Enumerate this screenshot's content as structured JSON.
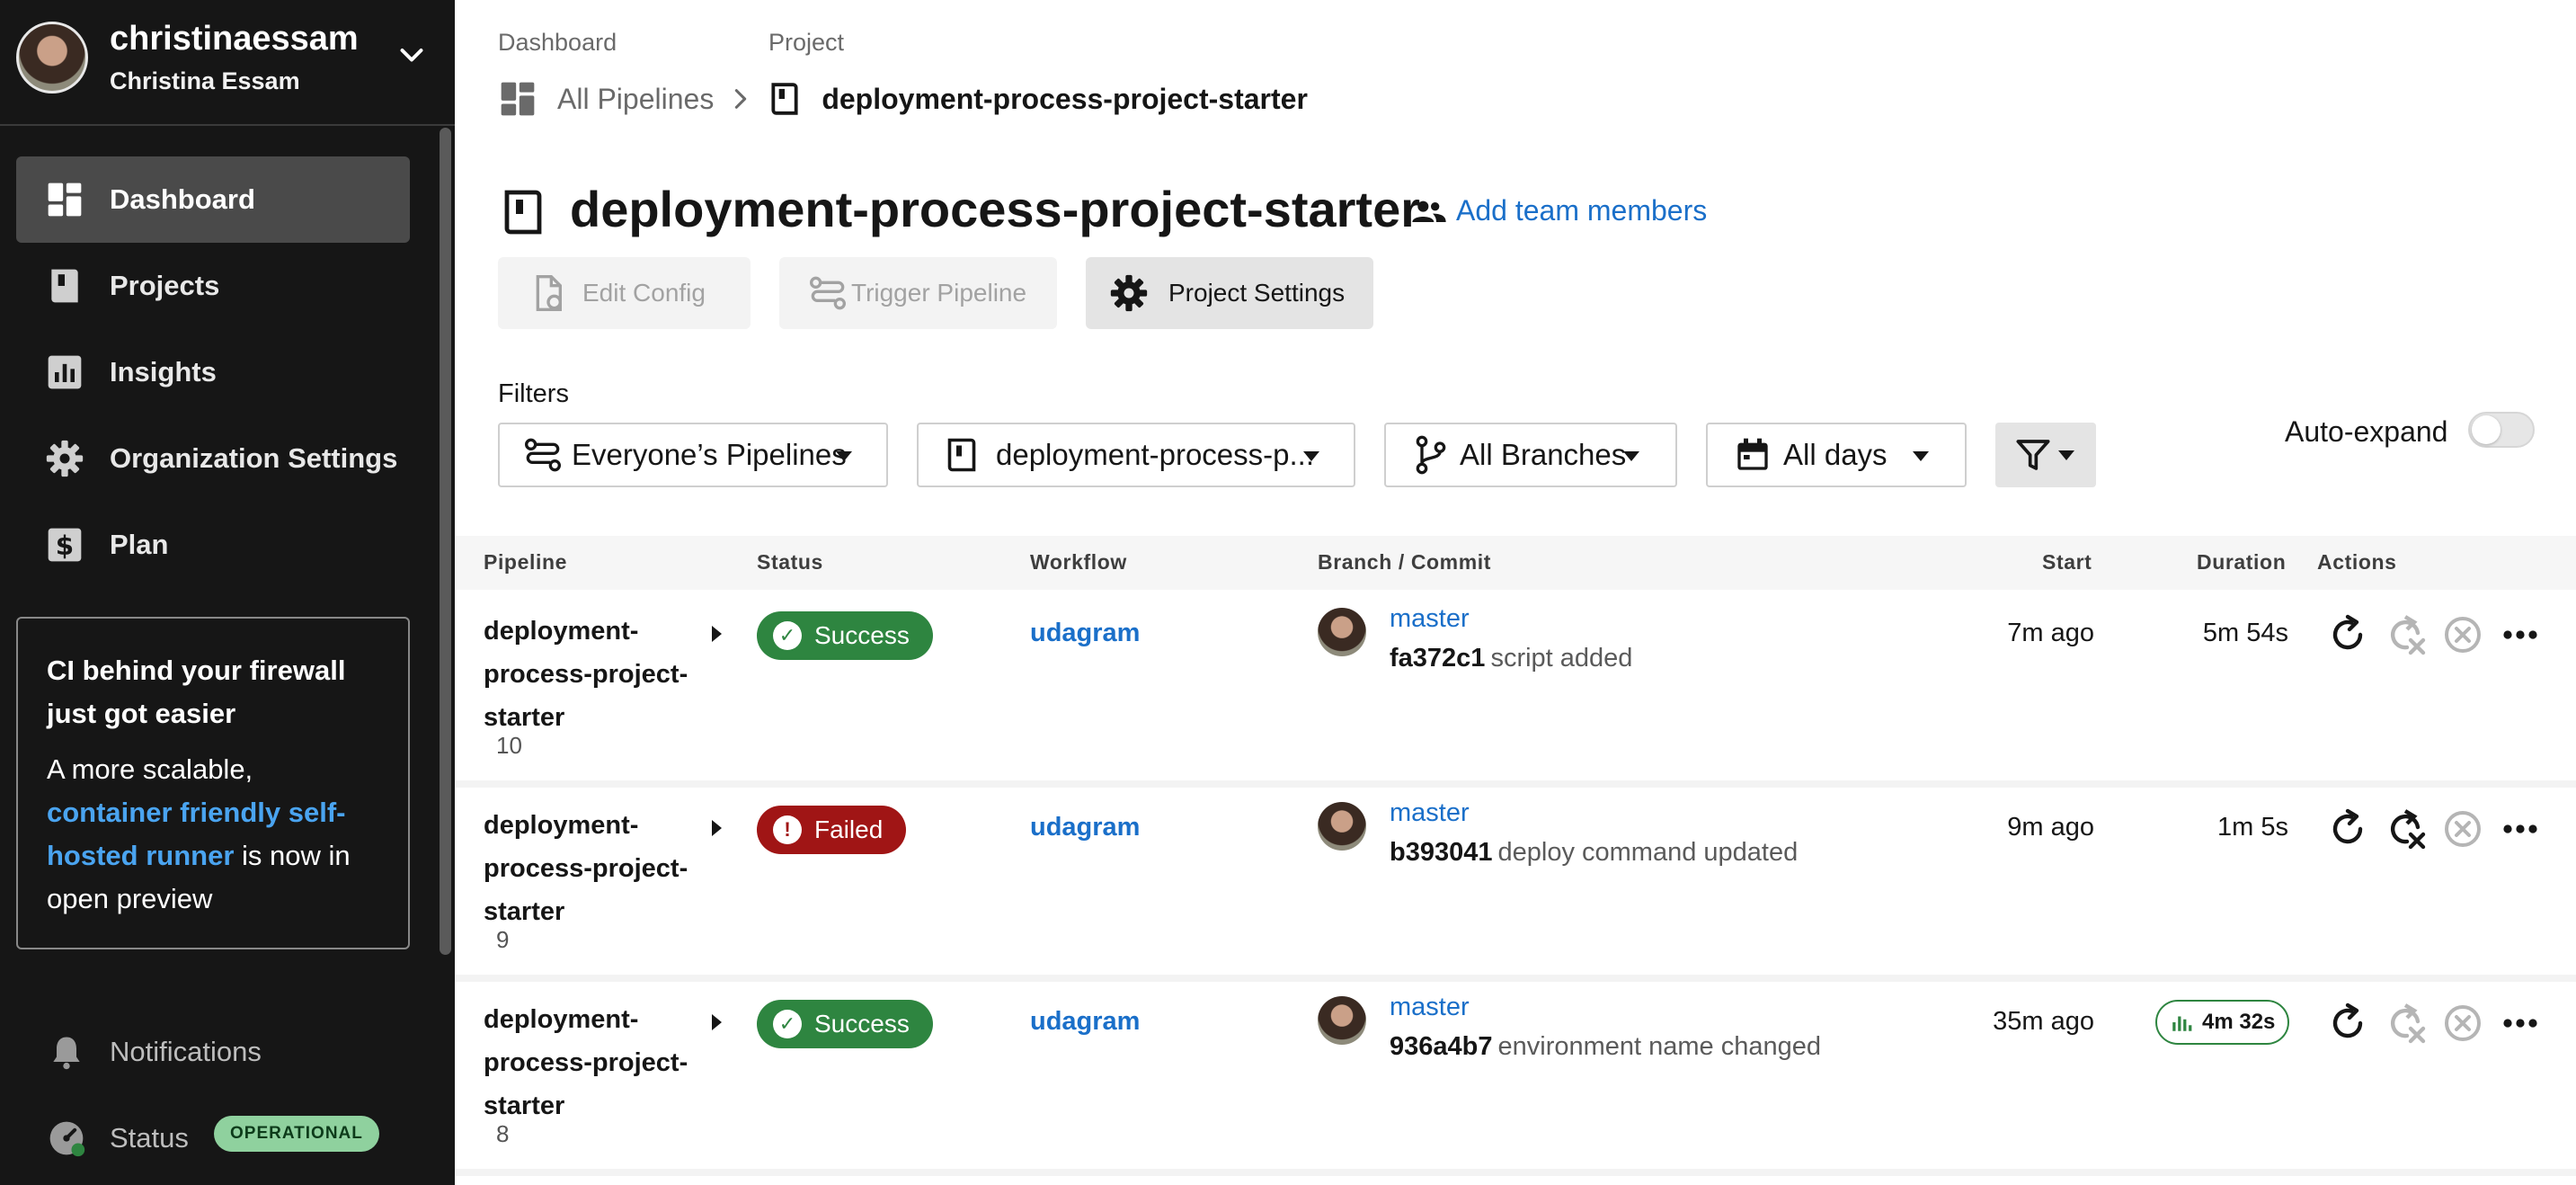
{
  "user": {
    "username": "christinaessam",
    "full_name": "Christina Essam"
  },
  "sidebar": {
    "nav": [
      {
        "label": "Dashboard",
        "icon": "dashboard-icon",
        "active": true
      },
      {
        "label": "Projects",
        "icon": "projects-icon",
        "active": false
      },
      {
        "label": "Insights",
        "icon": "insights-icon",
        "active": false
      },
      {
        "label": "Organization Settings",
        "icon": "gear-icon",
        "active": false
      },
      {
        "label": "Plan",
        "icon": "plan-icon",
        "active": false
      }
    ],
    "promo": {
      "title": "CI behind your firewall just got easier",
      "body_start": "A more scalable, ",
      "link": "container friendly self-hosted runner",
      "body_end": " is now in open preview"
    },
    "notifications_label": "Notifications",
    "status_label": "Status",
    "status_badge": "OPERATIONAL"
  },
  "breadcrumb": {
    "dashboard_head": "Dashboard",
    "project_head": "Project",
    "all_pipelines": "All Pipelines",
    "project": "deployment-process-project-starter"
  },
  "page": {
    "title": "deployment-process-project-starter",
    "add_team": "Add team members"
  },
  "buttons": {
    "edit_config": "Edit Config",
    "trigger_pipeline": "Trigger Pipeline",
    "project_settings": "Project Settings"
  },
  "filters": {
    "label": "Filters",
    "pipelines": "Everyone’s Pipelines",
    "project": "deployment-process-p...",
    "branches": "All Branches",
    "days": "All days",
    "auto_expand": "Auto-expand",
    "auto_expand_on": false
  },
  "table": {
    "headers": {
      "pipeline": "Pipeline",
      "status": "Status",
      "workflow": "Workflow",
      "branch_commit": "Branch / Commit",
      "start": "Start",
      "duration": "Duration",
      "actions": "Actions"
    },
    "rows": [
      {
        "pipeline": "deployment-process-project-starter",
        "number": "10",
        "status": "Success",
        "workflow": "udagram",
        "branch": "master",
        "hash": "fa372c1",
        "message": "script added",
        "start": "7m ago",
        "duration": "5m 54s"
      },
      {
        "pipeline": "deployment-process-project-starter",
        "number": "9",
        "status": "Failed",
        "workflow": "udagram",
        "branch": "master",
        "hash": "b393041",
        "message": "deploy command updated",
        "start": "9m ago",
        "duration": "1m 5s"
      },
      {
        "pipeline": "deployment-process-project-starter",
        "number": "8",
        "status": "Success",
        "workflow": "udagram",
        "branch": "master",
        "hash": "936a4b7",
        "message": "environment name changed",
        "start": "35m ago",
        "duration": "4m 32s"
      }
    ]
  },
  "colors": {
    "sidebar_bg": "#161616",
    "link_blue": "#1a6fc9",
    "success_green": "#2e8540",
    "failed_red": "#a01515",
    "operational_green": "#8fd19e"
  }
}
